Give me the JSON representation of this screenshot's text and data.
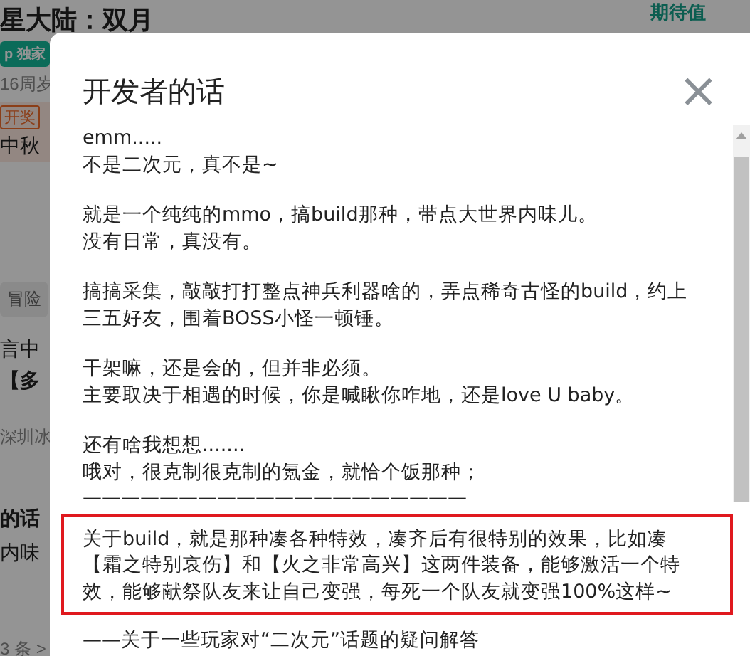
{
  "background_page": {
    "title": "星大陆：双月",
    "rating_label": "期待值",
    "badge": "p 独家",
    "age": "16周岁",
    "tag": "开奖",
    "news": "中秋",
    "genre": "冒险",
    "snippet_1": "言中",
    "snippet_2": "【多",
    "author": "深圳冰",
    "comment_title": "的话",
    "comment_text": "内味",
    "more": "3 条 >"
  },
  "dialog": {
    "title": "开发者的话",
    "close": "×",
    "paragraphs": [
      {
        "highlighted": false,
        "lines": [
          "emm.....",
          "不是二次元，真不是~"
        ]
      },
      {
        "highlighted": false,
        "lines": [
          "就是一个纯纯的mmo，搞build那种，带点大世界内味儿。",
          "没有日常，真没有。"
        ]
      },
      {
        "highlighted": false,
        "lines": [
          "搞搞采集，敲敲打打整点神兵利器啥的，弄点稀奇古怪的build，约上",
          "三五好友，围着BOSS小怪一顿锤。"
        ]
      },
      {
        "highlighted": false,
        "lines": [
          "干架嘛，还是会的，但并非必须。",
          "主要取决于相遇的时候，你是喊瞅你咋地，还是love U baby。"
        ]
      },
      {
        "highlighted": false,
        "lines": [
          "还有啥我想想.......",
          "哦对，很克制很克制的氪金，就恰个饭那种；",
          "————————————————————"
        ]
      },
      {
        "highlighted": true,
        "lines": [
          "关于build，就是那种凑各种特效，凑齐后有很特别的效果，比如凑",
          "【霜之特别哀伤】和【火之非常高兴】这两件装备，能够激活一个特",
          "效，能够献祭队友来让自己变强，每死一个队友就变强100%这样~"
        ]
      },
      {
        "highlighted": false,
        "lines": [
          "——关于一些玩家对“二次元”话题的疑问解答"
        ]
      }
    ]
  }
}
